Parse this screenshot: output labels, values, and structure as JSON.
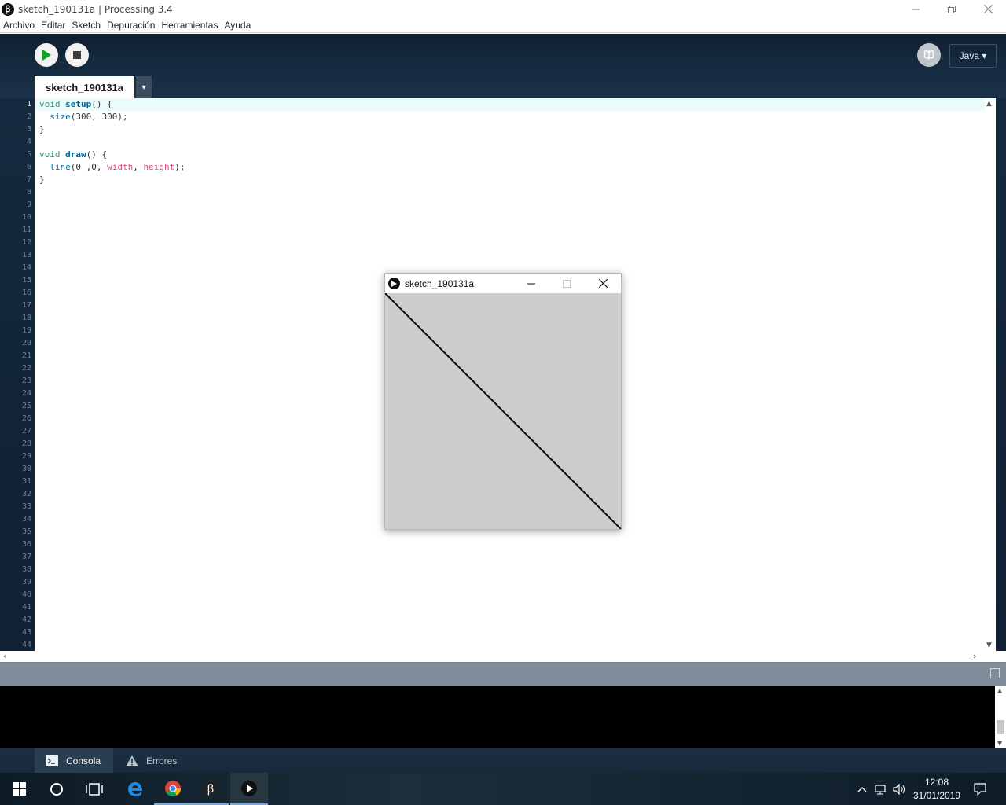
{
  "window": {
    "title": "sketch_190131a | Processing 3.4",
    "logo_text": "ꞵ"
  },
  "menu": [
    "Archivo",
    "Editar",
    "Sketch",
    "Depuración",
    "Herramientas",
    "Ayuda"
  ],
  "toolbar": {
    "mode_label": "Java ▾",
    "run_icon": "play-icon",
    "stop_icon": "stop-icon",
    "debug_icon": "debug-butterfly-icon"
  },
  "tab": {
    "name": "sketch_190131a",
    "menu_arrow": "▾"
  },
  "editor": {
    "line_count": 44,
    "current_line": 1,
    "lines": [
      [
        {
          "t": "void ",
          "c": "kw"
        },
        {
          "t": "setup",
          "c": "fn"
        },
        {
          "t": "() {",
          "c": ""
        }
      ],
      [
        {
          "t": "  ",
          "c": ""
        },
        {
          "t": "size",
          "c": "bi"
        },
        {
          "t": "(300, 300);",
          "c": ""
        }
      ],
      [
        {
          "t": "}",
          "c": ""
        }
      ],
      [],
      [
        {
          "t": "void ",
          "c": "kw"
        },
        {
          "t": "draw",
          "c": "fn"
        },
        {
          "t": "() {",
          "c": ""
        }
      ],
      [
        {
          "t": "  ",
          "c": ""
        },
        {
          "t": "line",
          "c": "bi"
        },
        {
          "t": "(0 ,0, ",
          "c": ""
        },
        {
          "t": "width",
          "c": "var"
        },
        {
          "t": ", ",
          "c": ""
        },
        {
          "t": "height",
          "c": "var"
        },
        {
          "t": ");",
          "c": ""
        }
      ],
      [
        {
          "t": "}",
          "c": ""
        }
      ]
    ]
  },
  "bottom_tabs": {
    "console": "Consola",
    "errors": "Errores"
  },
  "sketch_window": {
    "title": "sketch_190131a",
    "canvas_color": "#cccccc",
    "sketch_size": [
      300,
      300
    ],
    "line": [
      0,
      0,
      300,
      300
    ]
  },
  "taskbar": {
    "apps": [
      "windows-start-icon",
      "cortana-search-icon",
      "task-view-icon",
      "edge-icon",
      "chrome-icon",
      "processing-icon",
      "sketch-runner-icon"
    ],
    "time": "12:08",
    "date": "31/01/2019"
  },
  "colors": {
    "toolbar_bg": "#14293d",
    "keyword": "#33997e",
    "function": "#006699",
    "variable": "#d94a7a",
    "status_bar": "#7e8d99"
  }
}
